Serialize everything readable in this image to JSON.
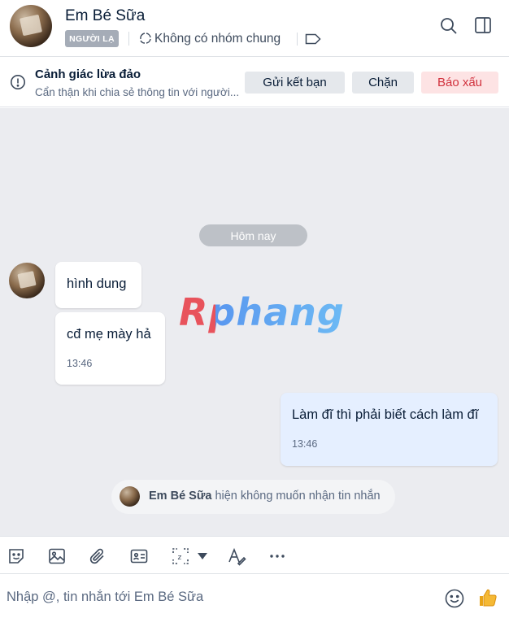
{
  "header": {
    "contact_name": "Em Bé Sữa",
    "stranger_badge": "NGƯỜI LẠ",
    "groups_text": "Không có nhóm chung"
  },
  "warning": {
    "title": "Cảnh giác lừa đảo",
    "description": "Cẩn thận khi chia sẻ thông tin với người...",
    "add_friend_label": "Gửi kết bạn",
    "block_label": "Chặn",
    "report_label": "Báo xấu"
  },
  "chat": {
    "date_divider": "Hôm nay",
    "messages": [
      {
        "from": "contact",
        "text": "hình dung",
        "time": ""
      },
      {
        "from": "contact",
        "text": "cđ mẹ mày hả",
        "time": "13:46"
      },
      {
        "from": "me",
        "text": "Làm đĩ thì phải biết cách làm đĩ",
        "time": "13:46"
      }
    ],
    "status_name": "Em Bé Sữa",
    "status_text": "hiện không muốn nhận tin nhắn",
    "watermark": "Rphang"
  },
  "composer": {
    "placeholder": "Nhập @, tin nhắn tới Em Bé Sữa",
    "value": ""
  },
  "colors": {
    "chat_background": "#ebecf0",
    "my_bubble": "#e5efff",
    "report_text": "#d1313d",
    "report_background": "#fde3e4"
  }
}
